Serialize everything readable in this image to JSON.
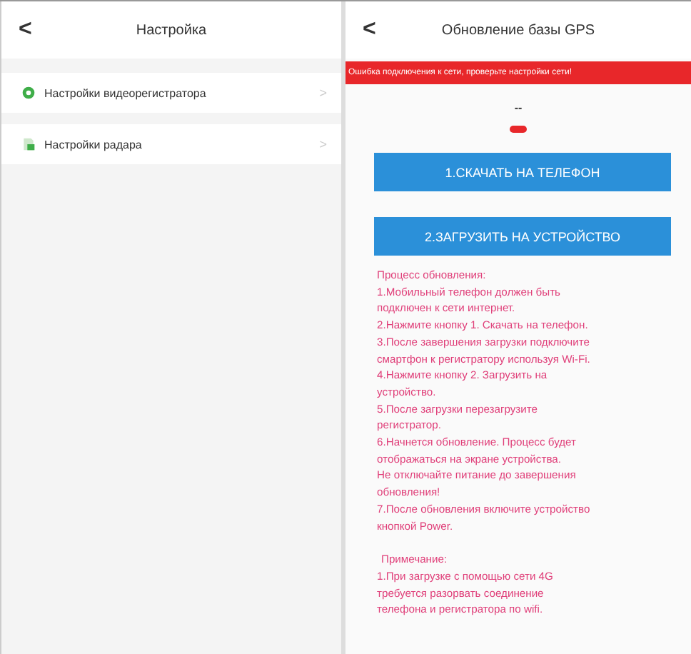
{
  "left_screen": {
    "header": {
      "back": "<",
      "title": "Настройка"
    },
    "items": [
      {
        "kind": "dashcam",
        "label": "Настройки видеорегистратора",
        "chevron": ">"
      },
      {
        "kind": "radar",
        "label": "Настройки радара",
        "chevron": ">"
      }
    ]
  },
  "right_screen": {
    "header": {
      "back": "<",
      "title": "Обновление базы GPS"
    },
    "error_banner": "Ошибка подключения к сети, проверьте настройки сети!",
    "progress_text": "--",
    "buttons": [
      "1.СКАЧАТЬ НА ТЕЛЕФОН",
      "2.ЗАГРУЗИТЬ НА УСТРОЙСТВО"
    ],
    "instructions": [
      "Процесс обновления:",
      "1.Мобильный телефон должен быть",
      "подключен к сети интернет.",
      "2.Нажмите кнопку 1. Скачать на телефон.",
      "3.После завершения загрузки подключите",
      "смартфон к регистратору используя Wi-Fi.",
      "4.Нажмите кнопку 2. Загрузить на",
      "устройство.",
      "5.После загрузки перезагрузите",
      "регистратор.",
      "6.Начнется обновление. Процесс будет",
      "отображаться на экране устройства.",
      "Не отключайте питание до завершения",
      "обновления!",
      "7.После обновления включите устройство",
      "кнопкой Power."
    ],
    "notes": [
      "Примечание:",
      "1.При загрузке с помощью сети 4G",
      "требуется разорвать соединение",
      "телефона и регистратора по wifi."
    ]
  }
}
